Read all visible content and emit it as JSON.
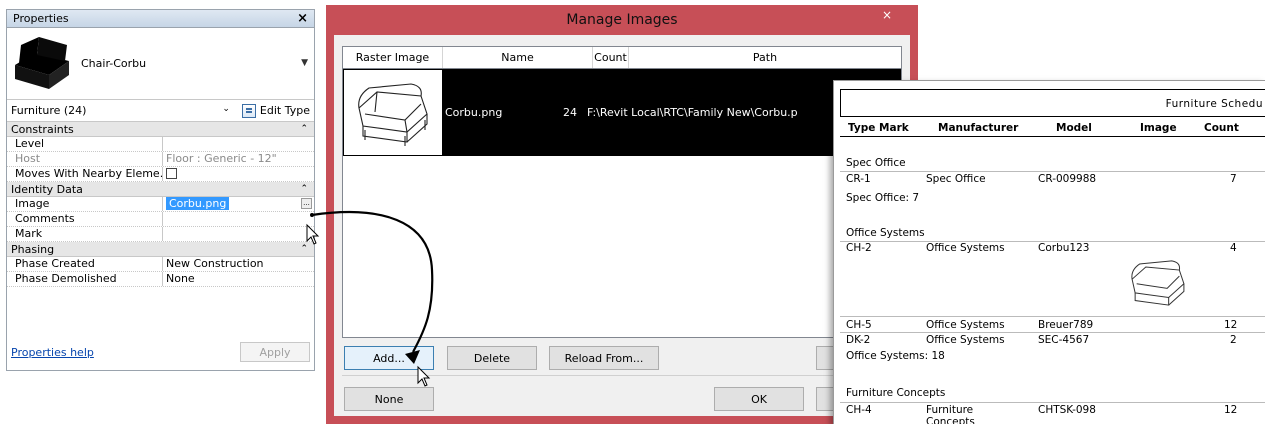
{
  "properties": {
    "title": "Properties",
    "close": "×",
    "type_name": "Chair-Corbu",
    "instance_filter": "Furniture (24)",
    "edit_type": "Edit Type",
    "groups": [
      {
        "name": "Constraints"
      },
      {
        "name": "Identity Data"
      },
      {
        "name": "Phasing"
      }
    ],
    "constraints": [
      {
        "name": "Level",
        "value": ""
      },
      {
        "name": "Host",
        "value": "Floor : Generic - 12\""
      },
      {
        "name": "Moves With Nearby Eleme...",
        "value": ""
      }
    ],
    "identity": [
      {
        "name": "Image",
        "value": "Corbu.png"
      },
      {
        "name": "Comments",
        "value": ""
      },
      {
        "name": "Mark",
        "value": ""
      }
    ],
    "phasing": [
      {
        "name": "Phase Created",
        "value": "New Construction"
      },
      {
        "name": "Phase Demolished",
        "value": "None"
      }
    ],
    "browse": "...",
    "help_link": "Properties help",
    "apply": "Apply"
  },
  "dialog": {
    "title": "Manage Images",
    "close": "×",
    "columns": [
      "Raster Image",
      "Name",
      "Count",
      "Path"
    ],
    "rows": [
      {
        "name": "Corbu.png",
        "count": "24",
        "path": "F:\\Revit Local\\RTC\\Family New\\Corbu.p"
      }
    ],
    "buttons": {
      "add": "Add...",
      "delete": "Delete",
      "reload": "Reload From...",
      "none": "None",
      "ok": "OK"
    }
  },
  "schedule": {
    "title": "Furniture Schedu",
    "columns": [
      "Type Mark",
      "Manufacturer",
      "Model",
      "Image",
      "Count"
    ],
    "groups": [
      {
        "header": "Spec Office",
        "rows": [
          {
            "mark": "CR-1",
            "mfr": "Spec Office",
            "model": "CR-009988",
            "count": "7"
          }
        ],
        "footer": "Spec Office: 7"
      },
      {
        "header": "Office Systems",
        "rows": [
          {
            "mark": "CH-2",
            "mfr": "Office Systems",
            "model": "Corbu123",
            "count": "4"
          },
          {
            "mark": "CH-5",
            "mfr": "Office Systems",
            "model": "Breuer789",
            "count": "12"
          },
          {
            "mark": "DK-2",
            "mfr": "Office Systems",
            "model": "SEC-4567",
            "count": "2"
          }
        ],
        "footer": "Office Systems: 18"
      },
      {
        "header": "Furniture Concepts",
        "rows": [
          {
            "mark": "CH-4",
            "mfr": "Furniture",
            "mfr2": "Concepts",
            "model": "CHTSK-098",
            "count": "12"
          }
        ]
      }
    ]
  },
  "colors": {
    "dialog_frame": "#c74f57",
    "selection": "#3399ff",
    "selected_row": "#000000"
  }
}
